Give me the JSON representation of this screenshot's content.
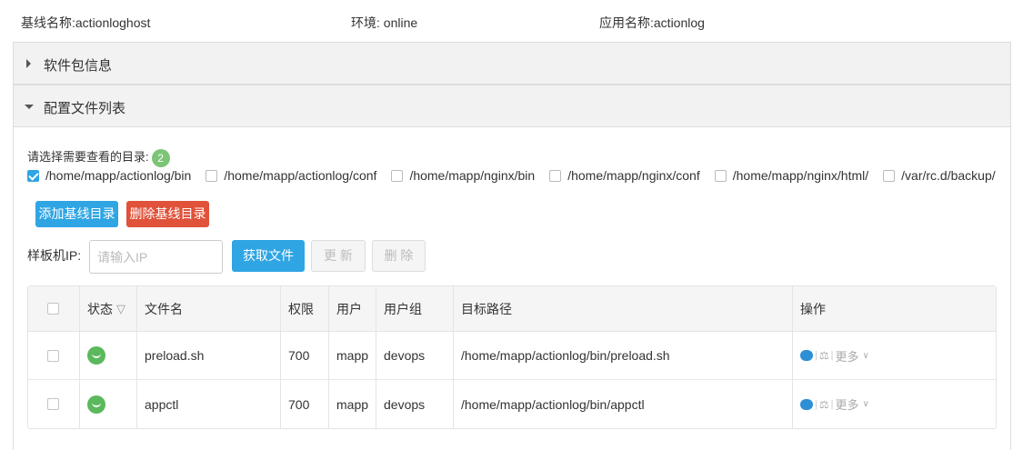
{
  "info": {
    "baseline_name": "基线名称:actionloghost",
    "env": "环境: online",
    "app_name": "应用名称:actionlog"
  },
  "panels": {
    "software_info": "软件包信息",
    "config_files": "配置文件列表"
  },
  "dir_select": {
    "label": "请选择需要查看的目录:",
    "badge": "2",
    "directories": [
      {
        "path": "/home/mapp/actionlog/bin",
        "checked": true
      },
      {
        "path": "/home/mapp/actionlog/conf",
        "checked": false
      },
      {
        "path": "/home/mapp/nginx/bin",
        "checked": false
      },
      {
        "path": "/home/mapp/nginx/conf",
        "checked": false
      },
      {
        "path": "/home/mapp/nginx/html/",
        "checked": false
      },
      {
        "path": "/var/rc.d/backup/",
        "checked": false
      }
    ]
  },
  "buttons": {
    "add_dir": "添加基线目录",
    "delete_dir": "删除基线目录",
    "fetch": "获取文件",
    "update": "更 新",
    "delete": "删 除"
  },
  "ip": {
    "label": "样板机IP:",
    "placeholder": "请输入IP",
    "value": ""
  },
  "table": {
    "headers": {
      "status": "状态",
      "filename": "文件名",
      "perm": "权限",
      "user": "用户",
      "group": "用户组",
      "target": "目标路径",
      "ops": "操作"
    },
    "rows": [
      {
        "filename": "preload.sh",
        "perm": "700",
        "user": "mapp",
        "group": "devops",
        "target": "/home/mapp/actionlog/bin/preload.sh",
        "status": "ok"
      },
      {
        "filename": "appctl",
        "perm": "700",
        "user": "mapp",
        "group": "devops",
        "target": "/home/mapp/actionlog/bin/appctl",
        "status": "ok"
      }
    ],
    "more_label": "更多"
  },
  "colors": {
    "primary": "#2fa5e4",
    "danger": "#e0523a",
    "success": "#5cb85c"
  }
}
